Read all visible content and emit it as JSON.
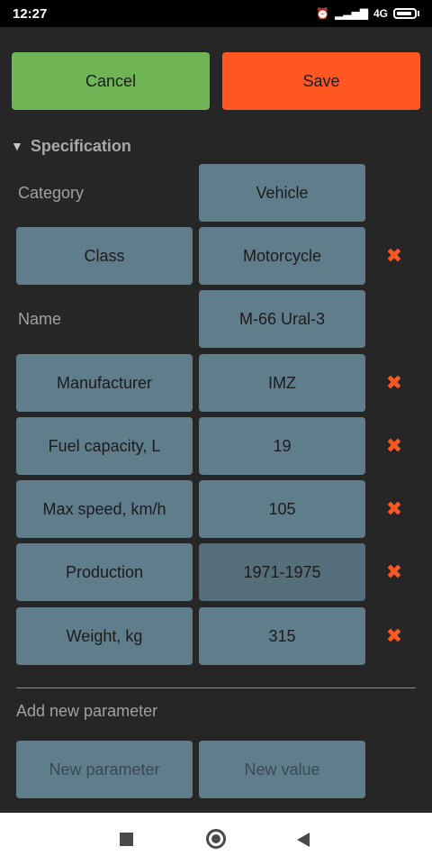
{
  "status": {
    "time": "12:27",
    "network": "4G"
  },
  "actions": {
    "cancel_label": "Cancel",
    "save_label": "Save"
  },
  "section": {
    "title": "Specification",
    "expanded": true
  },
  "params": [
    {
      "key": "Category",
      "value": "Vehicle",
      "editable_key": false,
      "deletable": false
    },
    {
      "key": "Class",
      "value": "Motorcycle",
      "editable_key": true,
      "deletable": true
    },
    {
      "key": "Name",
      "value": "M-66 Ural-3",
      "editable_key": false,
      "deletable": false
    },
    {
      "key": "Manufacturer",
      "value": "IMZ",
      "editable_key": true,
      "deletable": true
    },
    {
      "key": "Fuel capacity, L",
      "value": "19",
      "editable_key": true,
      "deletable": true
    },
    {
      "key": "Max speed, km/h",
      "value": "105",
      "editable_key": true,
      "deletable": true
    },
    {
      "key": "Production",
      "value": "1971-1975",
      "editable_key": true,
      "deletable": true
    },
    {
      "key": "Weight, kg",
      "value": "315",
      "editable_key": true,
      "deletable": true
    }
  ],
  "add_new": {
    "label": "Add new parameter",
    "param_placeholder": "New parameter",
    "value_placeholder": "New value"
  },
  "colors": {
    "cancel": "#6fb556",
    "save": "#ff5722",
    "cell": "#607d8b",
    "delete": "#ff5722"
  }
}
